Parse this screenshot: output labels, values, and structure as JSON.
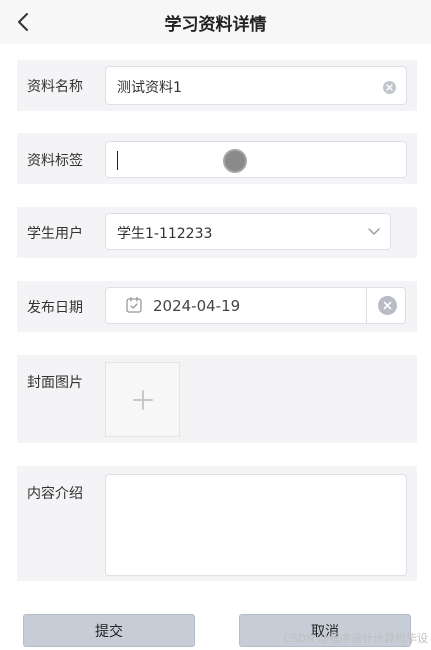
{
  "header": {
    "title": "学习资料详情",
    "back_icon": "chevron-left-icon"
  },
  "form": {
    "name": {
      "label": "资料名称",
      "value": "测试资料1",
      "clear_icon": "clear-circle-icon"
    },
    "tag": {
      "label": "资料标签",
      "value": ""
    },
    "user": {
      "label": "学生用户",
      "value": "学生1-112233",
      "dropdown_icon": "chevron-down-icon"
    },
    "date": {
      "label": "发布日期",
      "value": "2024-04-19",
      "calendar_icon": "calendar-icon",
      "clear_icon": "clear-circle-icon"
    },
    "cover": {
      "label": "封面图片",
      "upload_icon": "plus-icon"
    },
    "content": {
      "label": "内容介绍",
      "value": ""
    }
  },
  "actions": {
    "submit_label": "提交",
    "cancel_label": "取消"
  },
  "watermark": "CSDN @程序设计计算机毕设"
}
